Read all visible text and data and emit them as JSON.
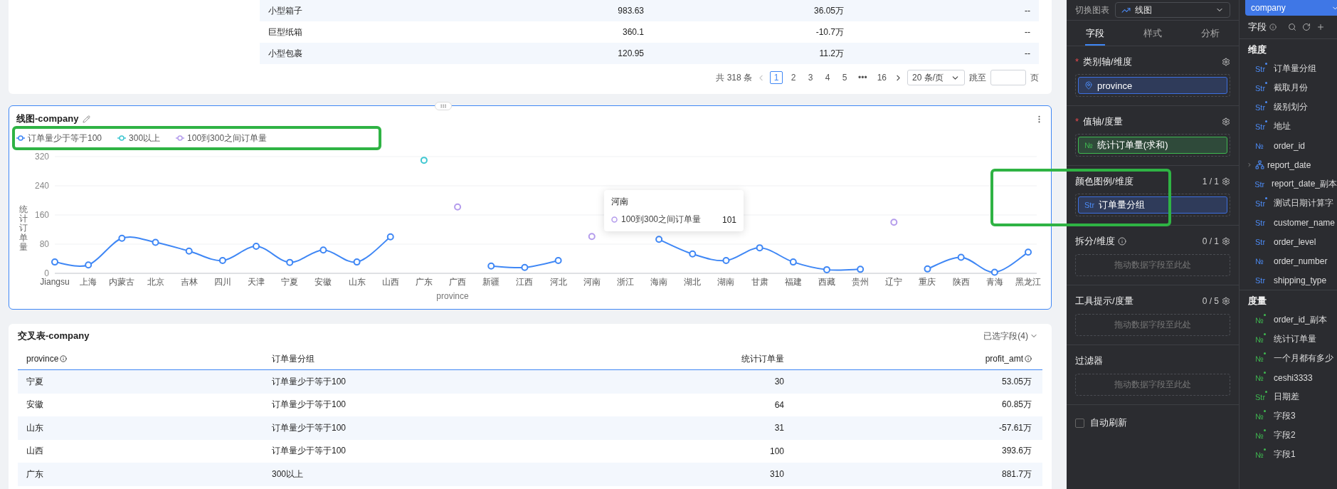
{
  "top_table": {
    "rows": [
      {
        "column_1": "小型箱子",
        "column_2": "983.63",
        "column_3": "36.05万",
        "column_4": "--"
      },
      {
        "column_1": "巨型纸箱",
        "column_2": "360.1",
        "column_3": "-10.7万",
        "column_4": "--"
      },
      {
        "column_1": "小型包裹",
        "column_2": "120.95",
        "column_3": "11.2万",
        "column_4": "--"
      }
    ]
  },
  "pagination": {
    "total": "共 318 条",
    "prev_disabled": true,
    "pages": [
      {
        "label": "1",
        "selected": true
      },
      {
        "label": "2",
        "selected": false
      },
      {
        "label": "3",
        "selected": false
      },
      {
        "label": "4",
        "selected": false
      },
      {
        "label": "5",
        "selected": false
      },
      {
        "label": "•••",
        "selected": false
      },
      {
        "label": "16",
        "selected": false
      }
    ],
    "page_size": "20 条/页",
    "jump_label": "跳至",
    "jump_suffix": "页"
  },
  "line_chart": {
    "title": "线图-company",
    "tooltip": {
      "title": "河南",
      "series": "100到300之间订单量",
      "value": "101",
      "color": "#b49cec"
    },
    "chart_data": {
      "type": "line",
      "xlabel": "province",
      "ylabel": "统计订单量",
      "grid": true,
      "categories": [
        "Jiangsu",
        "上海",
        "内蒙古",
        "北京",
        "吉林",
        "四川",
        "天津",
        "宁夏",
        "安徽",
        "山东",
        "山西",
        "广东",
        "广西",
        "新疆",
        "江西",
        "河北",
        "河南",
        "浙江",
        "海南",
        "湖北",
        "湖南",
        "甘肃",
        "福建",
        "西藏",
        "贵州",
        "辽宁",
        "重庆",
        "陕西",
        "青海",
        "黑龙江"
      ],
      "ylim": [
        0,
        320
      ],
      "yticks": [
        0,
        80,
        160,
        240,
        320
      ],
      "series": [
        {
          "name": "订单量少于等于100",
          "color": "#3f87f5",
          "marker": true,
          "values": [
            31,
            23,
            96,
            85,
            61,
            35,
            74,
            30,
            64,
            31,
            100,
            null,
            null,
            20,
            16,
            35,
            null,
            null,
            93,
            53,
            35,
            70,
            31,
            10,
            11,
            null,
            12,
            44,
            3,
            58
          ]
        },
        {
          "name": "300以上",
          "type": "scatter",
          "color": "#3fc7d1",
          "values": [
            null,
            null,
            null,
            null,
            null,
            null,
            null,
            null,
            null,
            null,
            null,
            310,
            null,
            null,
            null,
            null,
            null,
            null,
            null,
            null,
            null,
            null,
            null,
            null,
            null,
            null,
            null,
            null,
            null,
            null
          ]
        },
        {
          "name": "100到300之间订单量",
          "type": "scatter",
          "color": "#b49cec",
          "values": [
            null,
            null,
            null,
            null,
            null,
            null,
            null,
            null,
            null,
            null,
            null,
            null,
            182,
            null,
            null,
            null,
            101,
            null,
            null,
            null,
            null,
            null,
            null,
            null,
            null,
            140,
            null,
            null,
            null,
            null
          ]
        }
      ]
    }
  },
  "cross_table": {
    "title": "交叉表-company",
    "selected_fields": "已选字段(4)",
    "columns": [
      {
        "label": "province",
        "kind": "dimension",
        "info": true
      },
      {
        "label": "订单量分组",
        "kind": "dimension",
        "info": false
      },
      {
        "label": "统计订单量",
        "kind": "measure",
        "info": false
      },
      {
        "label": "profit_amt",
        "kind": "measure",
        "info": true
      }
    ],
    "rows": [
      [
        "宁夏",
        "订单量少于等于100",
        "30",
        "53.05万"
      ],
      [
        "安徽",
        "订单量少于等于100",
        "64",
        "60.85万"
      ],
      [
        "山东",
        "订单量少于等于100",
        "31",
        "-57.61万"
      ],
      [
        "山西",
        "订单量少于等于100",
        "100",
        "393.6万"
      ],
      [
        "广东",
        "300以上",
        "310",
        "881.7万"
      ]
    ]
  },
  "config_panel": {
    "switch_label": "切换图表",
    "chart_type": "线图",
    "tabs": [
      {
        "label": "字段",
        "selected": true
      },
      {
        "label": "样式",
        "selected": false
      },
      {
        "label": "分析",
        "selected": false
      }
    ],
    "sections": [
      {
        "title": "类别轴/维度",
        "required_mark": "*",
        "info": false,
        "settings": true,
        "chip": {
          "kind": "geo",
          "label": "province"
        }
      },
      {
        "title": "值轴/度量",
        "required_mark": "*",
        "info": false,
        "settings": true,
        "chip": {
          "kind": "measure",
          "icon": "№",
          "label": "统计订单量(求和)"
        }
      },
      {
        "title": "颜色图例/维度",
        "info": false,
        "settings": true,
        "count": "1 / 1",
        "chip": {
          "kind": "dimension",
          "icon": "Str",
          "label": "订单量分组"
        }
      },
      {
        "title": "拆分/维度",
        "info": true,
        "settings": true,
        "count": "0 / 1",
        "placeholder": "拖动数据字段至此处"
      },
      {
        "title": "工具提示/度量",
        "info": false,
        "settings": true,
        "count": "0 / 5",
        "placeholder": "拖动数据字段至此处"
      },
      {
        "title": "过滤器",
        "info": false,
        "settings": false,
        "placeholder": "拖动数据字段至此处"
      }
    ],
    "auto_refresh": {
      "label": "自动刷新",
      "checked": false
    }
  },
  "field_panel": {
    "dataset": "company",
    "title": "字段",
    "groups": [
      {
        "title": "维度",
        "kind": "dimension",
        "items": [
          {
            "kind": "field",
            "icon": "Str",
            "calculated": true,
            "label": "订单量分组"
          },
          {
            "kind": "field",
            "icon": "Str",
            "calculated": true,
            "label": "截取月份"
          },
          {
            "kind": "field",
            "icon": "Str",
            "calculated": true,
            "label": "级别划分"
          },
          {
            "kind": "field",
            "icon": "Str",
            "calculated": true,
            "label": "地址"
          },
          {
            "kind": "field",
            "icon": "№",
            "calculated": false,
            "label": "order_id"
          },
          {
            "kind": "hierarchy",
            "expanded": false,
            "label": "report_date"
          },
          {
            "kind": "field",
            "icon": "Str",
            "calculated": false,
            "label": "report_date_副本"
          },
          {
            "kind": "field",
            "icon": "Str",
            "calculated": true,
            "label": "测试日期计算字"
          },
          {
            "kind": "field",
            "icon": "Str",
            "calculated": false,
            "label": "customer_name"
          },
          {
            "kind": "field",
            "icon": "Str",
            "calculated": false,
            "label": "order_level"
          },
          {
            "kind": "field",
            "icon": "№",
            "calculated": false,
            "label": "order_number"
          },
          {
            "kind": "field",
            "icon": "Str",
            "calculated": false,
            "label": "shipping_type"
          }
        ]
      },
      {
        "title": "度量",
        "kind": "measure",
        "items": [
          {
            "kind": "field",
            "icon": "№",
            "calculated": true,
            "label": "order_id_副本"
          },
          {
            "kind": "field",
            "icon": "№",
            "calculated": true,
            "label": "统计订单量"
          },
          {
            "kind": "field",
            "icon": "№",
            "calculated": true,
            "label": "一个月都有多少"
          },
          {
            "kind": "field",
            "icon": "№",
            "calculated": true,
            "label": "ceshi3333"
          },
          {
            "kind": "field",
            "icon": "Str",
            "calculated": true,
            "label": "日期差"
          },
          {
            "kind": "field",
            "icon": "№",
            "calculated": true,
            "label": "字段3"
          },
          {
            "kind": "field",
            "icon": "№",
            "calculated": true,
            "label": "字段2"
          },
          {
            "kind": "field",
            "icon": "№",
            "calculated": true,
            "label": "字段1"
          }
        ]
      }
    ]
  }
}
